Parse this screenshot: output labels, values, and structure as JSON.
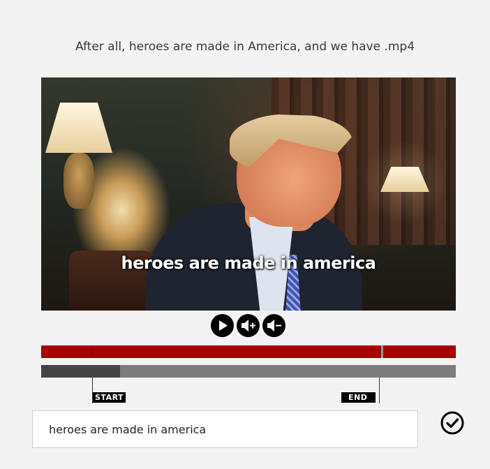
{
  "header": {
    "title": "After all, heroes are made in America, and we have .mp4"
  },
  "video": {
    "subtitle": "heroes are made in america"
  },
  "controls": {
    "play_icon": "play-icon",
    "volume_up_icon": "volume-up-icon",
    "volume_down_icon": "volume-down-icon"
  },
  "timeline": {
    "playhead_fraction": 0.82,
    "selection_fill_fraction": 0.19,
    "start_label": "START",
    "end_label": "END"
  },
  "caption_input": {
    "value": "heroes are made in america"
  },
  "confirm_icon": "checkmark-circle-icon",
  "colors": {
    "accent_red": "#a90000",
    "track_gray": "#7c7c7c",
    "track_fill": "#444444",
    "background": "#f3f3f3"
  }
}
